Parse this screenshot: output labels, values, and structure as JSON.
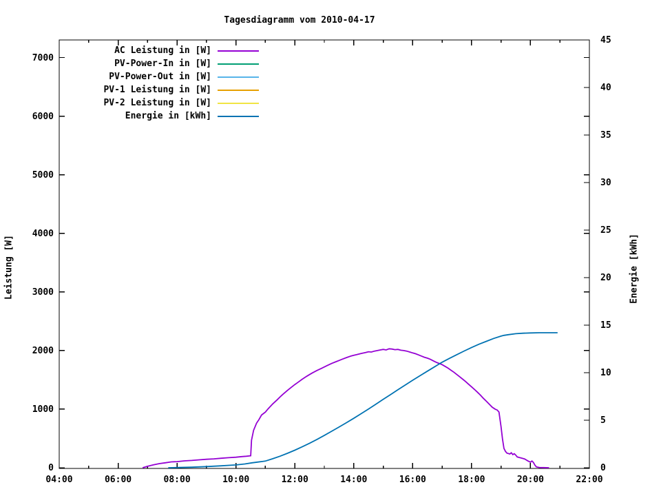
{
  "chart_data": {
    "type": "line",
    "title": "Tagesdiagramm vom 2010-04-17",
    "legend_position": "top-left-inside",
    "grid": false,
    "x_axis": {
      "range": [
        4,
        22
      ],
      "major_hours": [
        4,
        6,
        8,
        10,
        12,
        14,
        16,
        18,
        20,
        22
      ],
      "major_labels": [
        "04:00",
        "06:00",
        "08:00",
        "10:00",
        "12:00",
        "14:00",
        "16:00",
        "18:00",
        "20:00",
        "22:00"
      ],
      "minor_hours": [
        5,
        7,
        9,
        11,
        13,
        15,
        17,
        19,
        21
      ]
    },
    "y_left": {
      "label": "Leistung [W]",
      "range": [
        0,
        7300
      ],
      "ticks": [
        0,
        1000,
        2000,
        3000,
        4000,
        5000,
        6000,
        7000
      ],
      "tick_labels": [
        "0",
        "1000",
        "2000",
        "3000",
        "4000",
        "5000",
        "6000",
        "7000"
      ]
    },
    "y_right": {
      "label": "Energie [kWh]",
      "range": [
        0,
        45
      ],
      "ticks": [
        0,
        5,
        10,
        15,
        20,
        25,
        30,
        35,
        40,
        45
      ],
      "tick_labels": [
        "0",
        "5",
        "10",
        "15",
        "20",
        "25",
        "30",
        "35",
        "40",
        "45"
      ]
    },
    "series": [
      {
        "name": "AC Leistung in [W]",
        "color": "#9400d3",
        "axis": "left",
        "points": [
          [
            6.83,
            0
          ],
          [
            7.0,
            25
          ],
          [
            7.2,
            50
          ],
          [
            7.4,
            70
          ],
          [
            7.6,
            85
          ],
          [
            7.8,
            100
          ],
          [
            8.0,
            105
          ],
          [
            8.25,
            118
          ],
          [
            8.5,
            125
          ],
          [
            8.75,
            135
          ],
          [
            9.0,
            145
          ],
          [
            9.25,
            152
          ],
          [
            9.5,
            162
          ],
          [
            9.75,
            172
          ],
          [
            10.0,
            180
          ],
          [
            10.2,
            190
          ],
          [
            10.35,
            196
          ],
          [
            10.5,
            205
          ],
          [
            10.53,
            470
          ],
          [
            10.6,
            640
          ],
          [
            10.7,
            760
          ],
          [
            10.78,
            820
          ],
          [
            10.87,
            900
          ],
          [
            11.0,
            950
          ],
          [
            11.1,
            1010
          ],
          [
            11.25,
            1090
          ],
          [
            11.4,
            1160
          ],
          [
            11.5,
            1210
          ],
          [
            11.6,
            1255
          ],
          [
            11.75,
            1320
          ],
          [
            11.9,
            1380
          ],
          [
            12.0,
            1420
          ],
          [
            12.1,
            1455
          ],
          [
            12.25,
            1510
          ],
          [
            12.4,
            1560
          ],
          [
            12.5,
            1590
          ],
          [
            12.6,
            1620
          ],
          [
            12.75,
            1660
          ],
          [
            12.9,
            1695
          ],
          [
            13.0,
            1720
          ],
          [
            13.1,
            1745
          ],
          [
            13.25,
            1780
          ],
          [
            13.4,
            1810
          ],
          [
            13.5,
            1830
          ],
          [
            13.6,
            1850
          ],
          [
            13.75,
            1880
          ],
          [
            13.9,
            1905
          ],
          [
            14.0,
            1920
          ],
          [
            14.1,
            1930
          ],
          [
            14.25,
            1950
          ],
          [
            14.4,
            1965
          ],
          [
            14.5,
            1980
          ],
          [
            14.6,
            1975
          ],
          [
            14.7,
            1990
          ],
          [
            14.8,
            2000
          ],
          [
            14.9,
            2010
          ],
          [
            15.0,
            2020
          ],
          [
            15.1,
            2010
          ],
          [
            15.2,
            2030
          ],
          [
            15.3,
            2025
          ],
          [
            15.4,
            2015
          ],
          [
            15.5,
            2020
          ],
          [
            15.6,
            2005
          ],
          [
            15.7,
            2000
          ],
          [
            15.8,
            1990
          ],
          [
            15.9,
            1975
          ],
          [
            16.0,
            1960
          ],
          [
            16.1,
            1945
          ],
          [
            16.2,
            1925
          ],
          [
            16.3,
            1905
          ],
          [
            16.4,
            1885
          ],
          [
            16.5,
            1870
          ],
          [
            16.6,
            1850
          ],
          [
            16.7,
            1825
          ],
          [
            16.8,
            1800
          ],
          [
            16.9,
            1780
          ],
          [
            17.0,
            1760
          ],
          [
            17.1,
            1730
          ],
          [
            17.2,
            1700
          ],
          [
            17.3,
            1665
          ],
          [
            17.4,
            1630
          ],
          [
            17.5,
            1590
          ],
          [
            17.6,
            1550
          ],
          [
            17.7,
            1510
          ],
          [
            17.8,
            1470
          ],
          [
            17.9,
            1425
          ],
          [
            18.0,
            1380
          ],
          [
            18.1,
            1335
          ],
          [
            18.2,
            1290
          ],
          [
            18.3,
            1240
          ],
          [
            18.4,
            1185
          ],
          [
            18.5,
            1135
          ],
          [
            18.6,
            1085
          ],
          [
            18.7,
            1035
          ],
          [
            18.8,
            1000
          ],
          [
            18.87,
            985
          ],
          [
            18.93,
            950
          ],
          [
            19.0,
            700
          ],
          [
            19.05,
            490
          ],
          [
            19.1,
            330
          ],
          [
            19.15,
            280
          ],
          [
            19.2,
            250
          ],
          [
            19.3,
            235
          ],
          [
            19.35,
            255
          ],
          [
            19.4,
            225
          ],
          [
            19.45,
            240
          ],
          [
            19.5,
            215
          ],
          [
            19.55,
            185
          ],
          [
            19.62,
            175
          ],
          [
            19.7,
            165
          ],
          [
            19.8,
            150
          ],
          [
            19.9,
            120
          ],
          [
            20.0,
            95
          ],
          [
            20.05,
            115
          ],
          [
            20.1,
            90
          ],
          [
            20.15,
            45
          ],
          [
            20.2,
            15
          ],
          [
            20.3,
            5
          ],
          [
            20.45,
            2
          ],
          [
            20.63,
            0
          ]
        ]
      },
      {
        "name": "PV-Power-In in [W]",
        "color": "#009e73",
        "axis": "left",
        "points": []
      },
      {
        "name": "PV-Power-Out in [W]",
        "color": "#56b4e9",
        "axis": "left",
        "points": []
      },
      {
        "name": "PV-1 Leistung in [W]",
        "color": "#e69f00",
        "axis": "left",
        "points": []
      },
      {
        "name": "PV-2 Leistung in [W]",
        "color": "#f0e442",
        "axis": "left",
        "points": []
      },
      {
        "name": "Energie in [kWh]",
        "color": "#0072b2",
        "axis": "right",
        "points": [
          [
            7.7,
            0
          ],
          [
            8.0,
            0.02
          ],
          [
            8.5,
            0.06
          ],
          [
            9.0,
            0.12
          ],
          [
            9.5,
            0.2
          ],
          [
            10.0,
            0.3
          ],
          [
            10.3,
            0.4
          ],
          [
            10.55,
            0.52
          ],
          [
            10.75,
            0.6
          ],
          [
            11.0,
            0.7
          ],
          [
            11.25,
            0.95
          ],
          [
            11.5,
            1.22
          ],
          [
            11.75,
            1.52
          ],
          [
            12.0,
            1.85
          ],
          [
            12.25,
            2.2
          ],
          [
            12.5,
            2.58
          ],
          [
            12.75,
            2.98
          ],
          [
            13.0,
            3.4
          ],
          [
            13.25,
            3.84
          ],
          [
            13.5,
            4.28
          ],
          [
            13.75,
            4.74
          ],
          [
            14.0,
            5.2
          ],
          [
            14.25,
            5.69
          ],
          [
            14.5,
            6.18
          ],
          [
            14.75,
            6.69
          ],
          [
            15.0,
            7.2
          ],
          [
            15.25,
            7.7
          ],
          [
            15.5,
            8.2
          ],
          [
            15.75,
            8.7
          ],
          [
            16.0,
            9.2
          ],
          [
            16.25,
            9.68
          ],
          [
            16.5,
            10.16
          ],
          [
            16.75,
            10.63
          ],
          [
            17.0,
            11.1
          ],
          [
            17.25,
            11.51
          ],
          [
            17.5,
            11.9
          ],
          [
            17.75,
            12.28
          ],
          [
            18.0,
            12.65
          ],
          [
            18.25,
            12.99
          ],
          [
            18.5,
            13.3
          ],
          [
            18.75,
            13.6
          ],
          [
            19.0,
            13.85
          ],
          [
            19.1,
            13.93
          ],
          [
            19.25,
            14.0
          ],
          [
            19.5,
            14.1
          ],
          [
            19.75,
            14.15
          ],
          [
            20.0,
            14.18
          ],
          [
            20.3,
            14.2
          ],
          [
            20.92,
            14.2
          ]
        ]
      }
    ],
    "colors": {
      "axis": "#000000",
      "background": "#ffffff",
      "text": "#000000"
    }
  }
}
